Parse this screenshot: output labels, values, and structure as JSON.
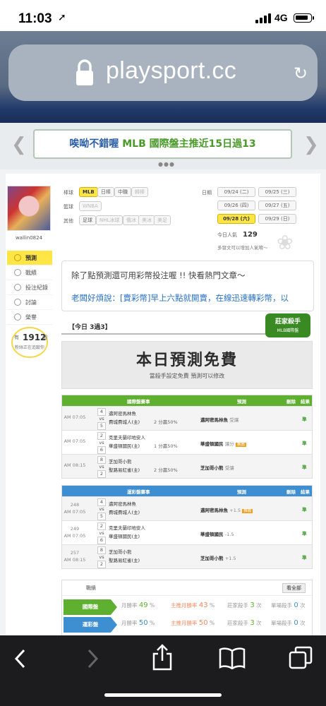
{
  "status_bar": {
    "time": "11:03",
    "network": "4G"
  },
  "browser": {
    "url": "playsport.cc"
  },
  "banner": {
    "part1": "唉呦不錯喔",
    "part2": "MLB 國際盤主推近15日過13"
  },
  "user": {
    "name": "wallin0824",
    "fans_label": "有",
    "fans_count": "1912",
    "fans_unit": "個",
    "fans_sub": "粉絲正在追蹤你"
  },
  "menu": [
    {
      "label": "預測",
      "active": true
    },
    {
      "label": "戰績",
      "active": false
    },
    {
      "label": "投注紀錄",
      "active": false
    },
    {
      "label": "討論",
      "active": false
    },
    {
      "label": "榮譽",
      "active": false
    }
  ],
  "filters": {
    "baseball_label": "棒球",
    "baseball": [
      "MLB",
      "日棒",
      "中職",
      "韓棒"
    ],
    "basketball_label": "籃球",
    "basketball": [
      "WNBA"
    ],
    "other_label": "其他",
    "other": [
      "足球",
      "NHL冰球",
      "俄冰",
      "美冰",
      "美足"
    ],
    "date_label": "日期",
    "dates": [
      "09/24 (二)",
      "09/25 (三)",
      "09/26 (四)",
      "09/27 (五)",
      "09/28 (六)",
      "09/29 (日)"
    ],
    "hits_label": "今日人氣",
    "hits": "129",
    "hint": "多發文可以增加人氣唷～"
  },
  "notice": {
    "line1": "除了點預測還可用彩幣投注喔 !! 快看熱門文章～",
    "line2": "老闆好煩說：[賣彩幣]早上六點就開賣，在線迅速轉彩幣，以"
  },
  "today": {
    "label": "【今日 3過3】",
    "badge_title": "莊家殺手",
    "badge_sub": "MLB國際盤"
  },
  "free_banner": {
    "title": "本日預測免費",
    "subtitle": "當殺手設定免費  預測可以修改"
  },
  "intl_table": {
    "headers": {
      "event": "國際盤賽事",
      "pick": "預測",
      "delete": "刪除",
      "result": "結果"
    },
    "rows": [
      {
        "time": "AM 07:05",
        "s1": "4",
        "s2": "5",
        "team1": "邁阿密馬林魚",
        "team2": "費城費城人(主)",
        "pct": "2 分贏50%",
        "pick": "邁阿密馬林魚",
        "pick_note": "受讓",
        "tag": "",
        "result": "準"
      },
      {
        "time": "AM 07:05",
        "s1": "2",
        "s2": "6",
        "team1": "克里夫蘭印地安人",
        "team2": "華盛頓國民(主)",
        "pct": "1 分贏50%",
        "pick": "華盛頓國民",
        "pick_note": "讓分",
        "tag": "推薦",
        "result": "準"
      },
      {
        "time": "AM 08:15",
        "s1": "8",
        "s2": "2",
        "team1": "芝加哥小熊",
        "team2": "聖路易紅雀(主)",
        "pct": "2 分贏50%",
        "pick": "芝加哥小熊",
        "pick_note": "受讓",
        "tag": "",
        "result": "準"
      }
    ]
  },
  "run_table": {
    "headers": {
      "event": "運彩盤賽事",
      "pick": "預測",
      "delete": "刪除",
      "result": "結果"
    },
    "rows": [
      {
        "no": "248",
        "time": "AM 07:05",
        "s1": "4",
        "s2": "5",
        "team1": "邁阿密馬林魚",
        "team2": "費城費城人(主)",
        "pick": "邁阿密馬林魚",
        "pick_note": "+1.5",
        "tag": "推薦",
        "result": "準"
      },
      {
        "no": "249",
        "time": "AM 07:05",
        "s1": "2",
        "s2": "6",
        "team1": "克里夫蘭印地安人",
        "team2": "華盛頓國民(主)",
        "pick": "華盛頓國民",
        "pick_note": "-1.5",
        "tag": "",
        "result": "準"
      },
      {
        "no": "257",
        "time": "AM 08:15",
        "s1": "8",
        "s2": "2",
        "team1": "芝加哥小熊",
        "team2": "聖路易紅雀(主)",
        "pick": "芝加哥小熊",
        "pick_note": "+1.5",
        "tag": "",
        "result": "準"
      }
    ]
  },
  "stats": {
    "title": "戰績",
    "view_all": "看全部",
    "rows": [
      {
        "tag": "國際盤",
        "c1": "月勝率",
        "v1": "49",
        "u1": "%",
        "c2": "主推月勝率",
        "v2": "43",
        "u2": "%",
        "c3": "莊家殺手",
        "v3": "3",
        "u3": "次",
        "c4": "單場殺手",
        "v4": "0",
        "u4": "次"
      },
      {
        "tag": "運彩盤",
        "c1": "月勝率",
        "v1": "50",
        "u1": "%",
        "c2": "主推月勝率",
        "v2": "50",
        "u2": "%",
        "c3": "莊家殺手",
        "v3": "3",
        "u3": "次",
        "c4": "單場殺手",
        "v4": "0",
        "u4": "次"
      }
    ]
  },
  "colors": {
    "intl": "#5fb030",
    "run": "#3d8fd1",
    "active": "#ffe646"
  }
}
